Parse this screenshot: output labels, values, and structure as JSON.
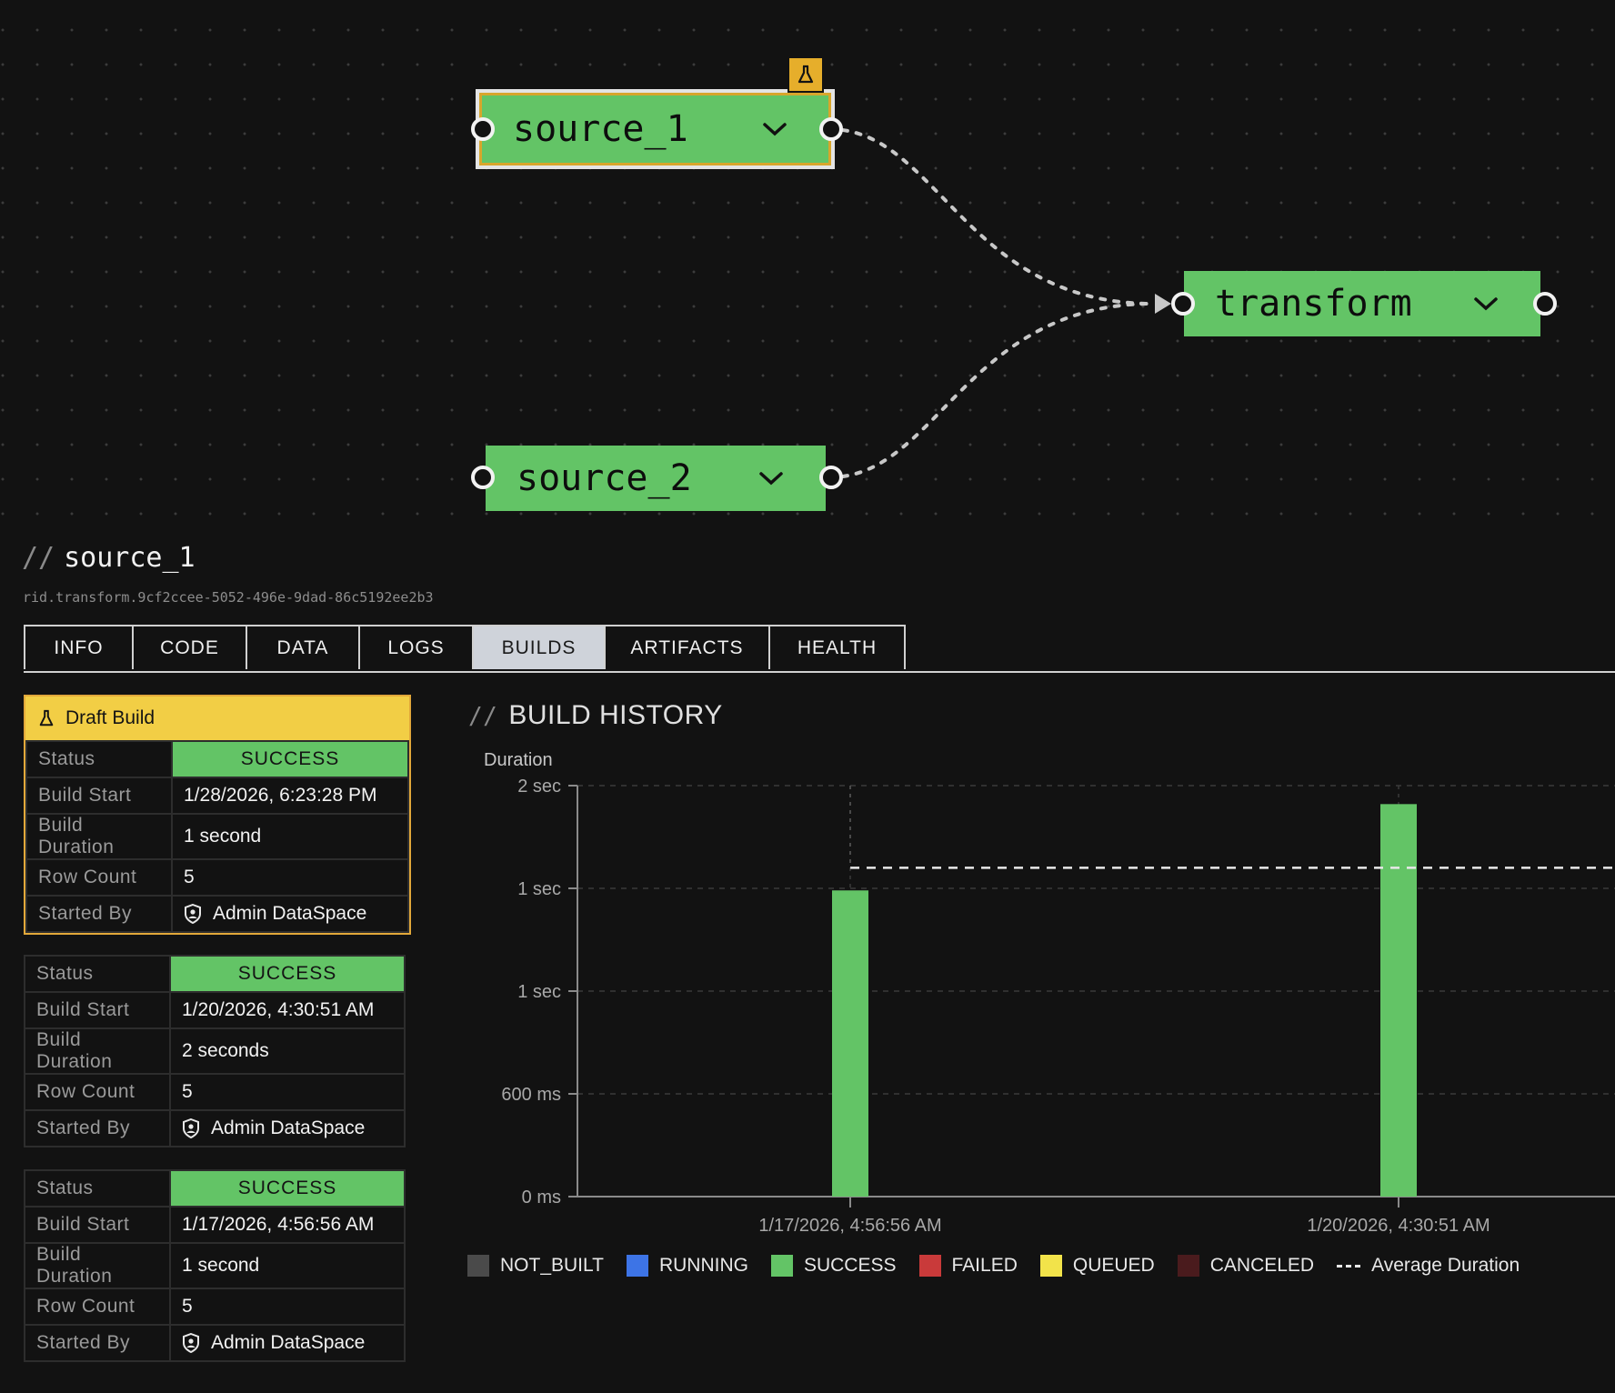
{
  "graph": {
    "nodes": [
      {
        "id": "source_1",
        "label": "source_1",
        "selected": true,
        "draft": true
      },
      {
        "id": "source_2",
        "label": "source_2",
        "selected": false,
        "draft": false
      },
      {
        "id": "transform",
        "label": "transform",
        "selected": false,
        "draft": false
      }
    ]
  },
  "panel": {
    "title": "source_1",
    "rid": "rid.transform.9cf2ccee-5052-496e-9dad-86c5192ee2b3",
    "tabs": [
      {
        "label": "INFO",
        "active": false
      },
      {
        "label": "CODE",
        "active": false
      },
      {
        "label": "DATA",
        "active": false
      },
      {
        "label": "LOGS",
        "active": false
      },
      {
        "label": "BUILDS",
        "active": true
      },
      {
        "label": "ARTIFACTS",
        "active": false
      },
      {
        "label": "HEALTH",
        "active": false
      }
    ]
  },
  "builds": {
    "draft_label": "Draft Build",
    "keys": {
      "status": "Status",
      "start": "Build Start",
      "duration": "Build Duration",
      "rows": "Row Count",
      "by": "Started By"
    },
    "items": [
      {
        "status": "SUCCESS",
        "start": "1/28/2026, 6:23:28 PM",
        "duration": "1 second",
        "rows": "5",
        "by": "Admin DataSpace"
      },
      {
        "status": "SUCCESS",
        "start": "1/20/2026, 4:30:51 AM",
        "duration": "2 seconds",
        "rows": "5",
        "by": "Admin DataSpace"
      },
      {
        "status": "SUCCESS",
        "start": "1/17/2026, 4:56:56 AM",
        "duration": "1 second",
        "rows": "5",
        "by": "Admin DataSpace"
      }
    ]
  },
  "chart_title": "BUILD HISTORY",
  "chart_data": {
    "type": "bar",
    "ylabel": "Duration",
    "y_unit": "seconds",
    "ylim": [
      0,
      2
    ],
    "y_ticks": [
      {
        "value": 0,
        "label": "0 ms"
      },
      {
        "value": 0.5,
        "label": "600 ms"
      },
      {
        "value": 1.0,
        "label": "1 sec"
      },
      {
        "value": 1.5,
        "label": "1 sec"
      },
      {
        "value": 2.0,
        "label": "2 sec"
      }
    ],
    "categories": [
      "1/17/2026, 4:56:56 AM",
      "1/20/2026, 4:30:51 AM"
    ],
    "values": [
      1.49,
      1.91
    ],
    "average_duration": 1.6,
    "grid": true,
    "legend_position": "bottom-left",
    "legend": [
      {
        "label": "NOT_BUILT",
        "color": "#4a4a4a"
      },
      {
        "label": "RUNNING",
        "color": "#3d74e6"
      },
      {
        "label": "SUCCESS",
        "color": "#63c466"
      },
      {
        "label": "FAILED",
        "color": "#c93a3a"
      },
      {
        "label": "QUEUED",
        "color": "#f2e34a"
      },
      {
        "label": "CANCELED",
        "color": "#4a1b1d"
      },
      {
        "label": "Average Duration",
        "dashed": true
      }
    ]
  }
}
